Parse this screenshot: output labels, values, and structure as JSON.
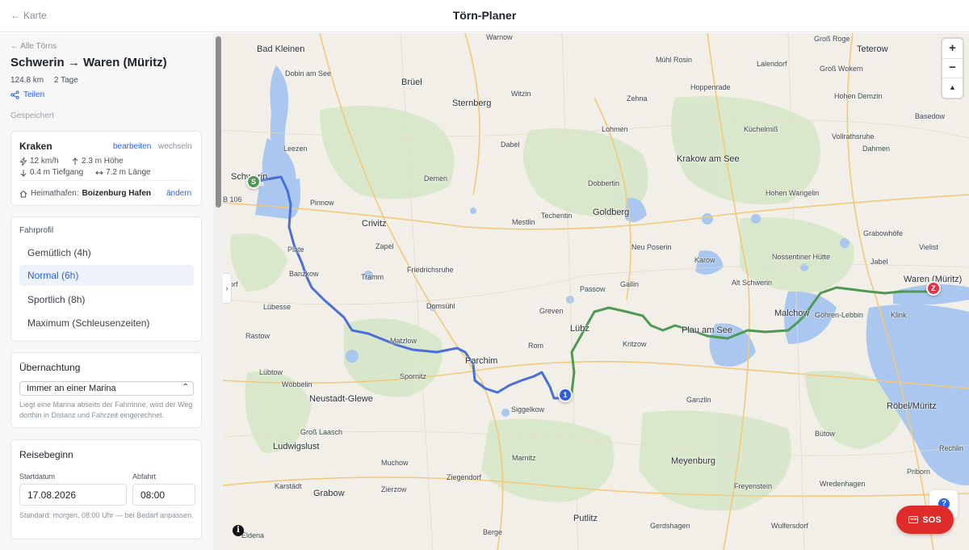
{
  "header": {
    "back_label": "Karte",
    "title": "Törn-Planer"
  },
  "sidebar": {
    "all_tours": "← Alle Törns",
    "route_title": "Schwerin → Waren (Müritz)",
    "distance": "124.8 km",
    "duration": "2 Tage",
    "share_label": "Teilen",
    "saved_label": "Gespeichert",
    "boat": {
      "name": "Kraken",
      "edit_label": "bearbeiten",
      "switch_label": "wechseln",
      "speed": "12 km/h",
      "height": "2.3 m Höhe",
      "draft": "0.4 m Tiefgang",
      "length": "7.2 m Länge",
      "home_prefix": "Heimathafen:",
      "home_port": "Boizenburg Hafen",
      "home_edit": "ändern"
    },
    "profile": {
      "label": "Fahrprofil",
      "options": [
        "Gemütlich (4h)",
        "Normal (6h)",
        "Sportlich (8h)",
        "Maximum (Schleusenzeiten)"
      ],
      "selected": "Normal (6h)"
    },
    "overnight": {
      "heading": "Übernachtung",
      "selected": "Immer an einer Marina",
      "help": "Liegt eine Marina abseits der Fahrrinne, wird der Weg dorthin in Distanz und Fahrzeit eingerechnet."
    },
    "travel": {
      "heading": "Reisebeginn",
      "date_label": "Startdatum",
      "date_value": "17.08.2026",
      "time_label": "Abfahrt",
      "time_value": "08:00",
      "help": "Standard: morgen, 08:00 Uhr — bei Bedarf anpassen."
    }
  },
  "map": {
    "zoom_in": "+",
    "zoom_out": "−",
    "compass": "▲",
    "info": "i",
    "help": "?",
    "sos_label": "SOS",
    "sos_icon_text": "SOS",
    "collapse_icon": "›",
    "markers": {
      "start": "S",
      "stop": "1",
      "end": "Z"
    },
    "route_colors": {
      "day1": "#4a6fd6",
      "day2": "#4e9a55"
    },
    "labels": [
      "Warnow",
      "Groß Roge",
      "Bad Kleinen",
      "Teterow",
      "Dobin am See",
      "Brüel",
      "Mühl Rosin",
      "Lalendorf",
      "Groß Wokern",
      "Witzin",
      "Hoppenrade",
      "Sternberg",
      "Zehna",
      "Hohen Demzin",
      "Basedow",
      "Lohmen",
      "Küchelmiß",
      "Dabel",
      "Leezen",
      "Dahmen",
      "Vollrathsruhe",
      "Krakow am See",
      "Schwerin",
      "Demen",
      "Dobbertin",
      "B 106",
      "Hohen Wangelin",
      "Pinnow",
      "Goldberg",
      "Techentin",
      "Crivitz",
      "Mestlin",
      "Grabowhöfe",
      "Vielist",
      "Zapel",
      "Neu Poserin",
      "Plate",
      "Nossentiner Hütte",
      "Karow",
      "Jabel",
      "Friedrichsruhe",
      "Waren (Müritz)",
      "Banzkow",
      "Tramm",
      "Alt Schwerin",
      "Gallin",
      "Passow",
      "Malchow",
      "Göhren-Lebbin",
      "Klink",
      "Lübesse",
      "Domsühl",
      "Greven",
      "Lübz",
      "Plau am See",
      "Rastow",
      "Matzlow",
      "Kritzow",
      "Rom",
      "Parchim",
      "Lübtow",
      "Spornitz",
      "Wöbbelin",
      "Neustadt-Glewe",
      "Siggelkow",
      "Ganzlin",
      "Röbel/Müritz",
      "Groß Laasch",
      "Bütow",
      "Ludwigslust",
      "Rechlin",
      "Muchow",
      "Marnitz",
      "Meyenburg",
      "Ziegendorf",
      "Priborn",
      "Karstädt",
      "Freyenstein",
      "Wredenhagen",
      "Grabow",
      "Zierzow",
      "Putlitz",
      "Gerdshagen",
      "Wulfersdorf",
      "Berge",
      "Eldena",
      "orf"
    ]
  }
}
